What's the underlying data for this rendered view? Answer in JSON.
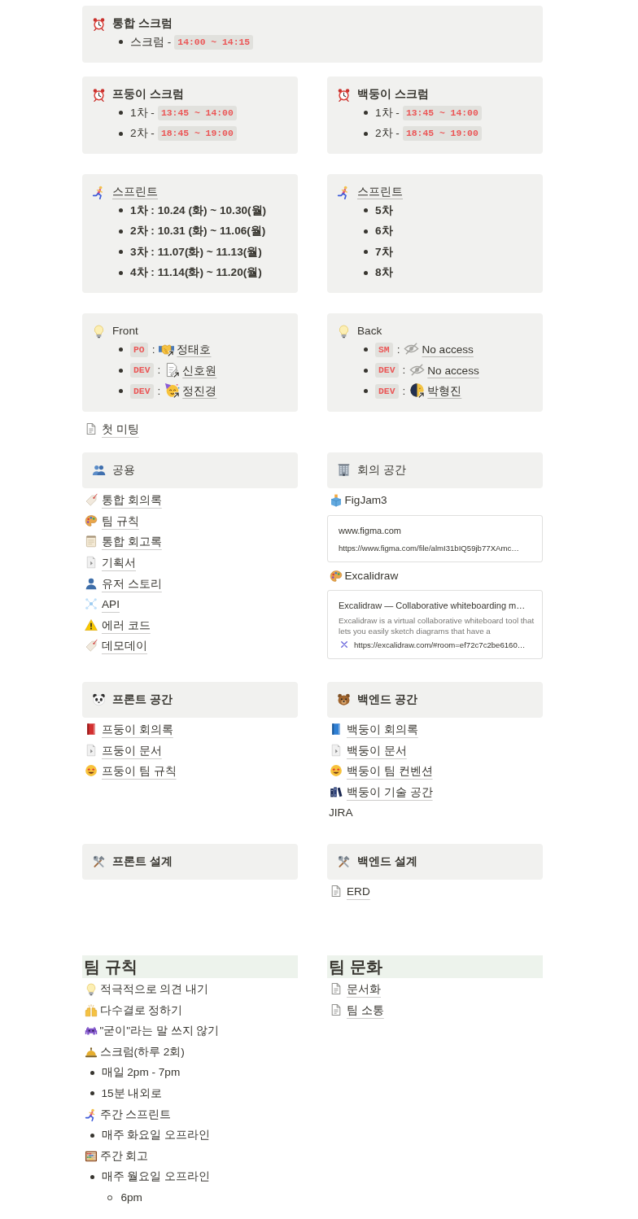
{
  "scrum": {
    "title": "통합 스크럼",
    "items": [
      {
        "label": "스크럼 -",
        "time": "14:00 ~ 14:15"
      }
    ]
  },
  "team_scrums": [
    {
      "title": "프둥이 스크럼",
      "items": [
        {
          "label": "1차 -",
          "time": "13:45 ~ 14:00"
        },
        {
          "label": "2차 -",
          "time": "18:45 ~ 19:00"
        }
      ]
    },
    {
      "title": "백둥이 스크럼",
      "items": [
        {
          "label": "1차 -",
          "time": "13:45 ~ 14:00"
        },
        {
          "label": "2차 -",
          "time": "18:45 ~ 19:00"
        }
      ]
    }
  ],
  "sprints": [
    {
      "title": "스프린트",
      "items": [
        "1차 : 10.24 (화) ~ 10.30(월)",
        "2차 : 10.31 (화) ~ 11.06(월)",
        "3차 : 11.07(화) ~ 11.13(월)",
        "4차 : 11.14(화) ~ 11.20(월)"
      ]
    },
    {
      "title": "스프린트",
      "items": [
        "5차",
        "6차",
        "7차",
        "8차"
      ]
    }
  ],
  "teams": [
    {
      "title": "Front",
      "members": [
        {
          "role": "PO",
          "separator": ":",
          "name": "정태호"
        },
        {
          "role": "DEV",
          "separator": ":",
          "name": "신호원"
        },
        {
          "role": "DEV",
          "separator": ":",
          "name": "정진경"
        }
      ]
    },
    {
      "title": "Back",
      "members": [
        {
          "role": "SM",
          "separator": ":",
          "name": "No access"
        },
        {
          "role": "DEV",
          "separator": ":",
          "name": "No access"
        },
        {
          "role": "DEV",
          "separator": ":",
          "name": "박형진"
        }
      ]
    }
  ],
  "first_meeting": "첫 미팅",
  "common": {
    "title": "공용",
    "pages": [
      "통합 회의록",
      "팀 규칙",
      "통합 회고록",
      "기획서",
      "유저 스토리",
      "API",
      "에러 코드",
      "데모데이"
    ]
  },
  "meeting_space": {
    "title": "회의 공간",
    "links": [
      {
        "title": "FigJam3",
        "bookmark": {
          "title": "www.figma.com",
          "url": "https://www.figma.com/file/almI31bIQ59jb77XAmc…"
        }
      },
      {
        "title": "Excalidraw",
        "bookmark": {
          "title": "Excalidraw — Collaborative whiteboarding m…",
          "description": "Excalidraw is a virtual collaborative whiteboard tool that lets you easily sketch diagrams that have a",
          "url": "https://excalidraw.com/#room=ef72c7c2be6160…"
        }
      }
    ]
  },
  "spaces": [
    {
      "title": "프론트 공간",
      "pages": [
        "프둥이 회의록",
        "프둥이 문서",
        "프둥이 팀 규칙"
      ]
    },
    {
      "title": "백엔드 공간",
      "pages": [
        "백둥이 회의록",
        "백둥이 문서",
        "백둥이 팀 컨벤션",
        "백둥이 기술 공간"
      ],
      "note": "JIRA"
    }
  ],
  "designs": [
    {
      "title": "프론트 설계"
    },
    {
      "title": "백엔드 설계",
      "pages": [
        "ERD"
      ]
    }
  ],
  "rules": {
    "title": "팀 규칙",
    "items": [
      {
        "text": "적극적으로 의견 내기"
      },
      {
        "text": "다수결로 정하기"
      },
      {
        "text": "\"굳이\"라는 말 쓰지 않기"
      },
      {
        "text": "스크럼(하루 2회)",
        "children": [
          {
            "text": "매일 2pm - 7pm"
          },
          {
            "text": "15분 내외로"
          }
        ]
      },
      {
        "text": "주간 스프린트",
        "children": [
          {
            "text": "매주 화요일 오프라인"
          }
        ]
      },
      {
        "text": "주간 회고",
        "children": [
          {
            "text": "매주 월요일 오프라인",
            "children": [
              {
                "text": "6pm"
              }
            ]
          }
        ]
      }
    ]
  },
  "culture": {
    "title": "팀 문화",
    "pages": [
      "문서화",
      "팀 소통"
    ]
  }
}
